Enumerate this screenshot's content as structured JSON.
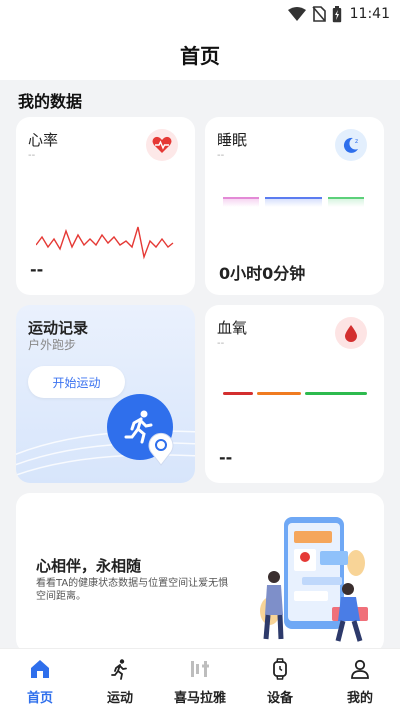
{
  "status_bar": {
    "time": "11:41"
  },
  "header": {
    "title": "首页"
  },
  "my_data": {
    "section_title": "我的数据",
    "heart_rate": {
      "title": "心率",
      "sub": "--",
      "value": "--"
    },
    "sleep": {
      "title": "睡眠",
      "sub": "--",
      "value": "0小时0分钟"
    },
    "exercise": {
      "title": "运动记录",
      "sub": "户外跑步",
      "button": "开始运动"
    },
    "blood_oxygen": {
      "title": "血氧",
      "sub": "--",
      "value": "--"
    }
  },
  "promo": {
    "title": "心相伴，永相随",
    "subtitle": "看看TA的健康状态数据与位置空间让爱无惧空间距离。"
  },
  "nav": [
    {
      "label": "首页",
      "icon": "home-icon",
      "active": true
    },
    {
      "label": "运动",
      "icon": "running-icon",
      "active": false
    },
    {
      "label": "喜马拉雅",
      "icon": "ximalaya-icon",
      "active": false
    },
    {
      "label": "设备",
      "icon": "watch-icon",
      "active": false
    },
    {
      "label": "我的",
      "icon": "person-icon",
      "active": false
    }
  ],
  "colors": {
    "accent": "#2f6fec",
    "heart": "#e53935",
    "sleep_bars": [
      "#e38ad6",
      "#5b7cf0",
      "#5cd07a"
    ],
    "spo2_bars": [
      "#d32f2f",
      "#f07b20",
      "#2dba4e"
    ]
  }
}
